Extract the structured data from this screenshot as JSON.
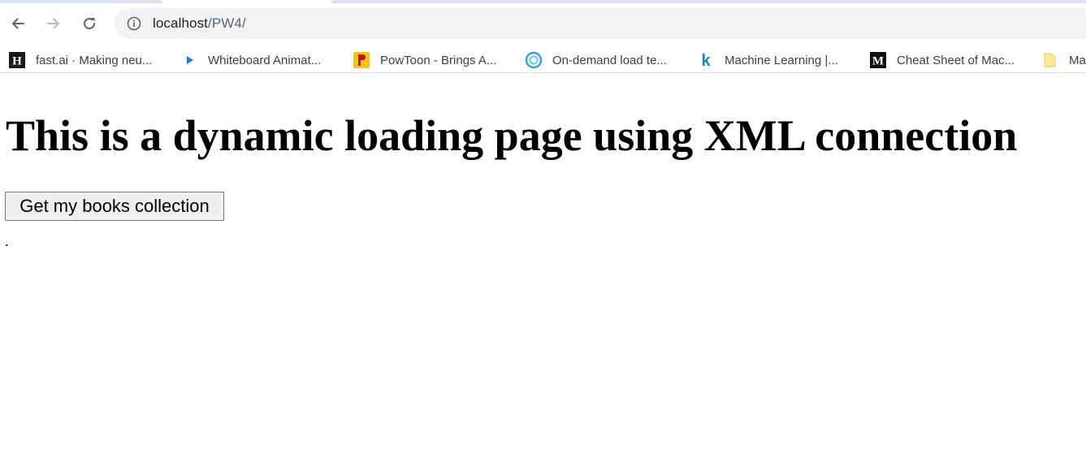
{
  "browser": {
    "address_bar": {
      "host": "localhost",
      "path": "/PW4/"
    },
    "bookmarks": [
      {
        "label": "fast.ai · Making neu...",
        "icon": "fastai-h-icon"
      },
      {
        "label": "Whiteboard Animat...",
        "icon": "play-icon"
      },
      {
        "label": "PowToon - Brings A...",
        "icon": "powtoon-icon"
      },
      {
        "label": "On-demand load te...",
        "icon": "loadtest-icon"
      },
      {
        "label": "Machine Learning |...",
        "icon": "k-icon"
      },
      {
        "label": "Cheat Sheet of Mac...",
        "icon": "medium-m-icon"
      },
      {
        "label": "Ma",
        "icon": "folder-icon"
      }
    ]
  },
  "page": {
    "heading": "This is a dynamic loading page using XML connection",
    "button_label": "Get my books collection",
    "result_text": "."
  }
}
